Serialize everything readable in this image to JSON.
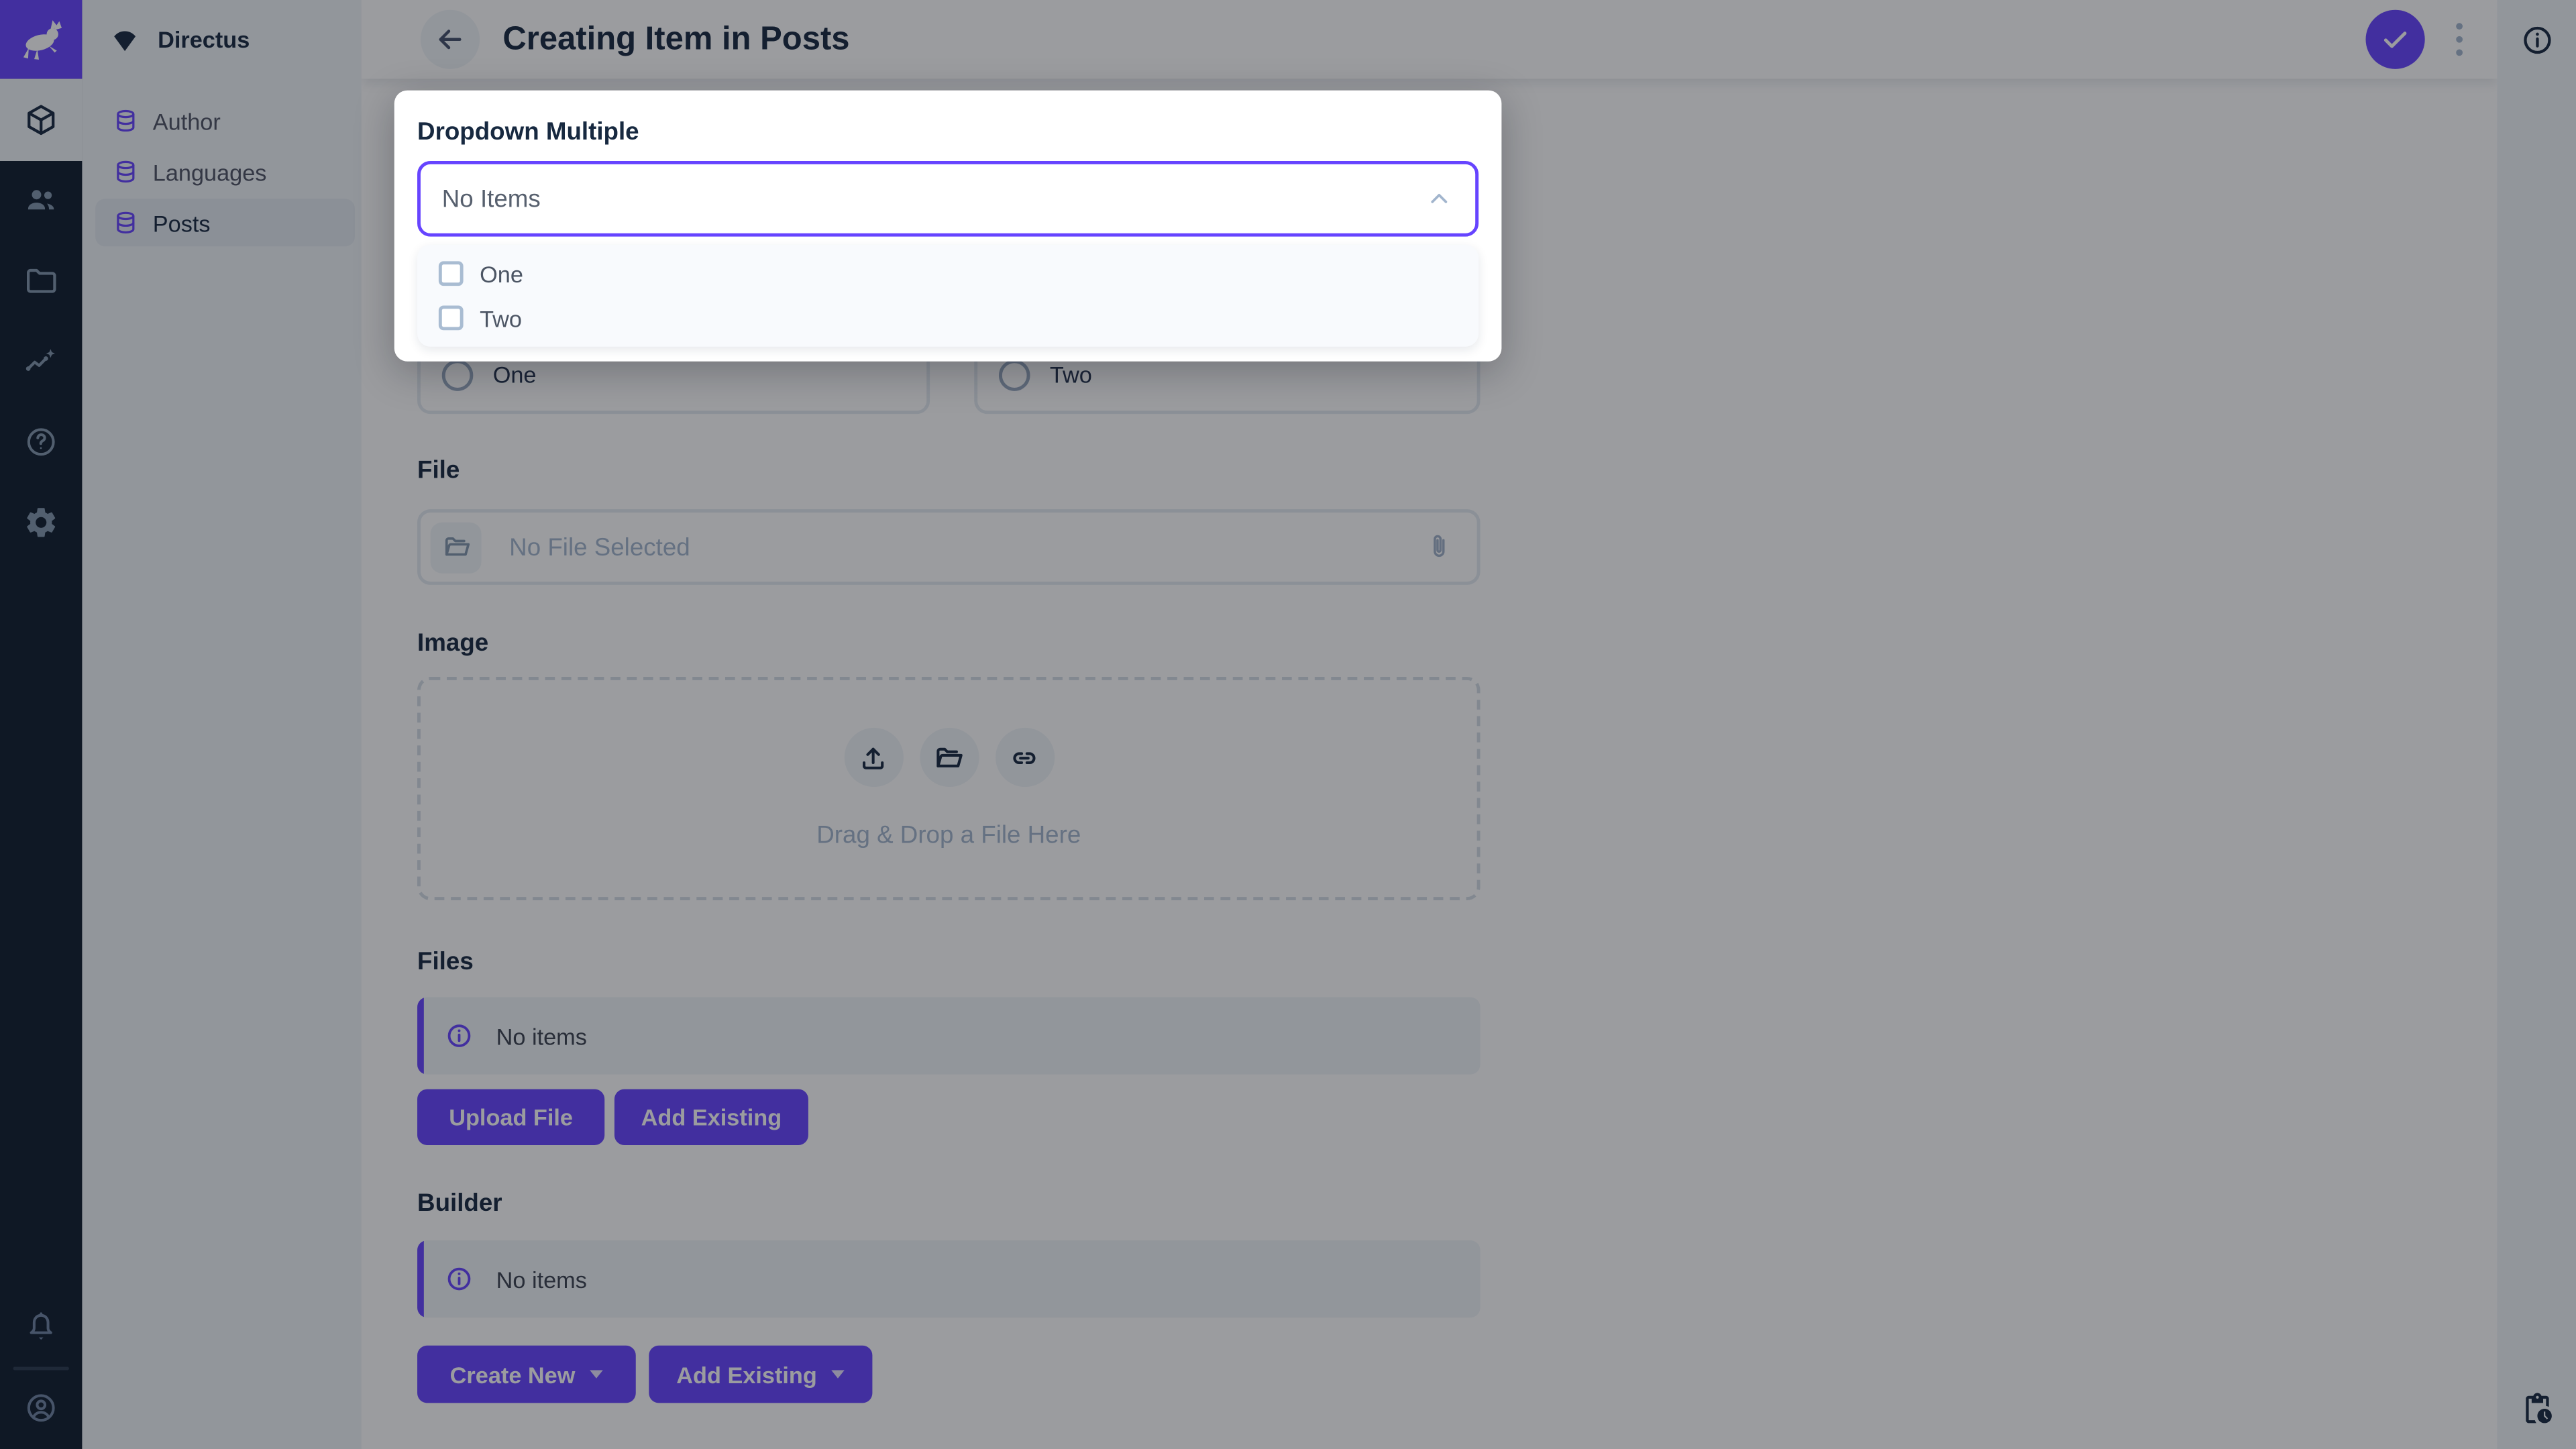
{
  "colors": {
    "accent": "#6644FF",
    "module_bar_bg": "#0E1C2E",
    "panel_bg": "#F0F4F9"
  },
  "project": {
    "name": "Directus"
  },
  "module_bar": {
    "modules": [
      "content",
      "users",
      "files",
      "insights",
      "help",
      "settings"
    ],
    "bottom": [
      "notifications",
      "account"
    ]
  },
  "nav": {
    "items": [
      {
        "label": "Author",
        "active": false
      },
      {
        "label": "Languages",
        "active": false
      },
      {
        "label": "Posts",
        "active": true
      }
    ]
  },
  "header": {
    "title": "Creating Item in Posts"
  },
  "form": {
    "dropdown_multiple": {
      "label": "Dropdown Multiple",
      "value": "No Items",
      "open": true,
      "options": [
        {
          "label": "One",
          "checked": false
        },
        {
          "label": "Two",
          "checked": false
        }
      ]
    },
    "dropdown_radio": {
      "options": [
        {
          "label": "One",
          "selected": false
        },
        {
          "label": "Two",
          "selected": false
        }
      ]
    },
    "file": {
      "label": "File",
      "placeholder": "No File Selected"
    },
    "image": {
      "label": "Image",
      "drop_text": "Drag & Drop a File Here"
    },
    "files": {
      "label": "Files",
      "empty_text": "No items",
      "upload_button": "Upload File",
      "add_button": "Add Existing"
    },
    "builder": {
      "label": "Builder",
      "empty_text": "No items",
      "create_button": "Create New",
      "add_button": "Add Existing"
    }
  }
}
